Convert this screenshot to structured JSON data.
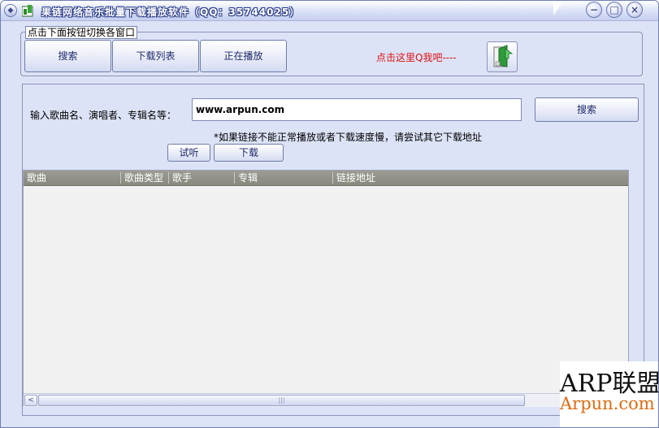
{
  "window": {
    "title": "果链网络音乐批量下载播放软件（QQ：35744025）",
    "controls": {
      "minimize": "−",
      "maximize": "□",
      "close": "×"
    }
  },
  "nav_group": {
    "caption": "点击下面按钮切换各窗口",
    "buttons": [
      {
        "label": "搜索"
      },
      {
        "label": "下载列表"
      },
      {
        "label": "正在播放"
      }
    ],
    "qq_link": "点击这里Q我吧----",
    "qq_icon": "qq-chat-icon"
  },
  "search": {
    "label": "输入歌曲名、演唱者、专辑名等：",
    "input_value": "www.arpun.com",
    "button": "搜索"
  },
  "hint": "*如果链接不能正常播放或者下载速度慢，请尝试其它下载地址",
  "actions": {
    "listen": "试听",
    "download": "下载"
  },
  "table": {
    "columns": [
      "歌曲",
      "歌曲类型",
      "歌手",
      "专辑",
      "链接地址"
    ],
    "rows": []
  },
  "scrollbar": {
    "left_arrow": "<",
    "right_arrow": ">",
    "thumb_grip": "|||"
  },
  "watermark": {
    "line1": "ARP联盟",
    "line2": "Arpun.com"
  },
  "colors": {
    "window_bg": "#dde3f6",
    "qq_link": "#e01010",
    "table_header_bg": "#8f8f87",
    "watermark_orange": "#e06a10"
  }
}
